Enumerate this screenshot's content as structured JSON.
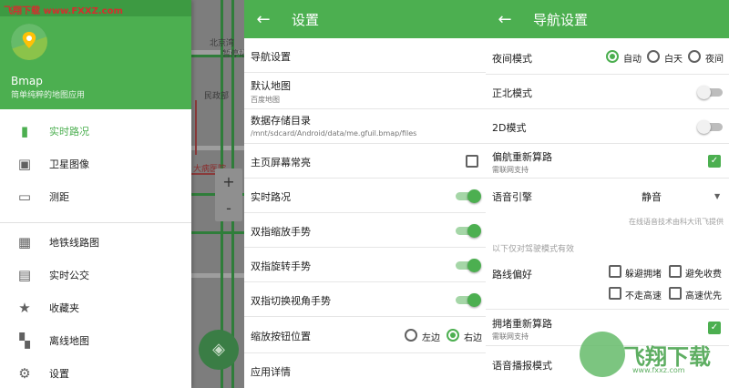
{
  "watermark_top": "飞翔下载 www.FXXZ.com",
  "panel1": {
    "app_name": "Bmap",
    "app_subtitle": "简单纯粹的地图应用",
    "menu": [
      {
        "label": "实时路况",
        "icon": "traffic-light-icon"
      },
      {
        "label": "卫星图像",
        "icon": "image-icon"
      },
      {
        "label": "测距",
        "icon": "ruler-icon"
      },
      {
        "label": "地铁线路图",
        "icon": "subway-icon"
      },
      {
        "label": "实时公交",
        "icon": "bus-icon"
      },
      {
        "label": "收藏夹",
        "icon": "star-icon"
      },
      {
        "label": "离线地图",
        "icon": "map-icon"
      },
      {
        "label": "设置",
        "icon": "gear-icon"
      }
    ],
    "map_labels": [
      "北京湾",
      "暂停站",
      "民政部",
      "大病医院"
    ],
    "zoom_in": "+",
    "zoom_out": "-"
  },
  "panel2": {
    "title": "设置",
    "rows": {
      "nav": "导航设置",
      "default_map": "默认地图",
      "default_map_sub": "百度地图",
      "storage": "数据存储目录",
      "storage_sub": "/mnt/sdcard/Android/data/me.gfuil.bmap/files",
      "keep_screen": "主页屏幕常亮",
      "traffic": "实时路况",
      "pinch_zoom": "双指缩放手势",
      "rotate": "双指旋转手势",
      "tilt": "双指切换视角手势",
      "zoom_pos": "缩放按钮位置",
      "zoom_left": "左边",
      "zoom_right": "右边",
      "about": "应用详情"
    }
  },
  "panel3": {
    "title": "导航设置",
    "night_mode": "夜间模式",
    "night_opts": [
      "自动",
      "白天",
      "夜间"
    ],
    "north": "正北模式",
    "mode2d": "2D模式",
    "reroute": "偏航重新算路",
    "reroute_sub": "需联网支持",
    "voice": "语音引擎",
    "voice_value": "静音",
    "voice_note": "在线语音技术由科大讯飞提供",
    "drive_note": "以下仅对驾驶模式有效",
    "route_pref": "路线偏好",
    "pref_opts": [
      "躲避拥堵",
      "避免收费",
      "不走高速",
      "高速优先"
    ],
    "jam_reroute": "拥堵重新算路",
    "jam_reroute_sub": "需联网支持",
    "voice_broadcast": "语音播报模式",
    "watermark": "飞翔下载",
    "watermark_url": "www.fxxz.com"
  }
}
